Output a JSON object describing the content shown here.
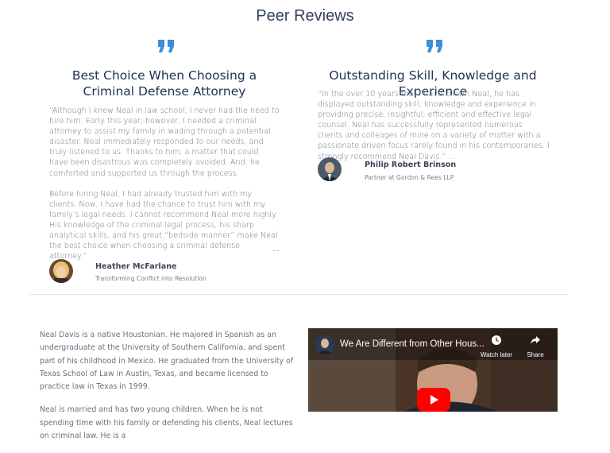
{
  "section_title": "Peer Reviews",
  "reviews": [
    {
      "heading": "Best Choice When Choosing a Criminal Defense Attorney",
      "paragraphs": [
        "“Although I knew Neal in law school, I never had the need to hire him. Early this year, however, I needed a criminal attorney to assist my family in wading through a potential disaster. Neal immediately responded to our needs, and truly listened to us. Thanks to him, a matter that could have been disastrous was completely avoided. And, he comforted and supported us through the process.",
        "Before hiring Neal, I had already trusted him with my clients. Now, I have had the chance to trust him with my family’s legal needs. I cannot recommend Neal more highly. His knowledge of the criminal legal process, his sharp analytical skills, and his great “bedside manner” make Neal the best choice when choosing a criminal defense attorney.”"
      ],
      "more": "...",
      "author_name": "Heather McFarlane",
      "author_role": "Transforming Conflict into Resolution"
    },
    {
      "heading": "Outstanding Skill, Knowledge and Experience",
      "paragraphs": [
        "“In the over 10 years that I have known Neal, he has displayed outstanding skill, knowledge and experience in providing precise, insightful, efficient and effective legal counsel. Neal has successfully represented numerous clients and colleages of mine on a variety of matter with a passionate driven focus rarely found in his contemporaries. I strongly recommend Neal Davis.”  ..."
      ],
      "author_name": "Philip Robert Brinson",
      "author_role": "Partner at Gordon & Rees LLP"
    }
  ],
  "bio": {
    "paragraph1": "Neal Davis is a native Houstonian. He majored in Spanish as an undergraduate at the University of Southern California, and spent part of his childhood in Mexico. He graduated from the University of Texas School of Law in Austin, Texas, and became licensed to practice law in Texas in 1999.",
    "paragraph2": "Neal is married and has two young children. When he is not spending time with his family or defending his clients, Neal lectures on criminal law. He is a"
  },
  "video": {
    "title": "We Are Different from Other Hous...",
    "watch_later": "Watch later",
    "share": "Share"
  },
  "colors": {
    "accent_blue": "#3b8fd9",
    "heading_navy": "#1f3050",
    "youtube_red": "#ff0000"
  },
  "icons": {
    "quote": "quote-icon",
    "watch_later": "clock-icon",
    "share": "share-icon",
    "play": "play-icon"
  }
}
